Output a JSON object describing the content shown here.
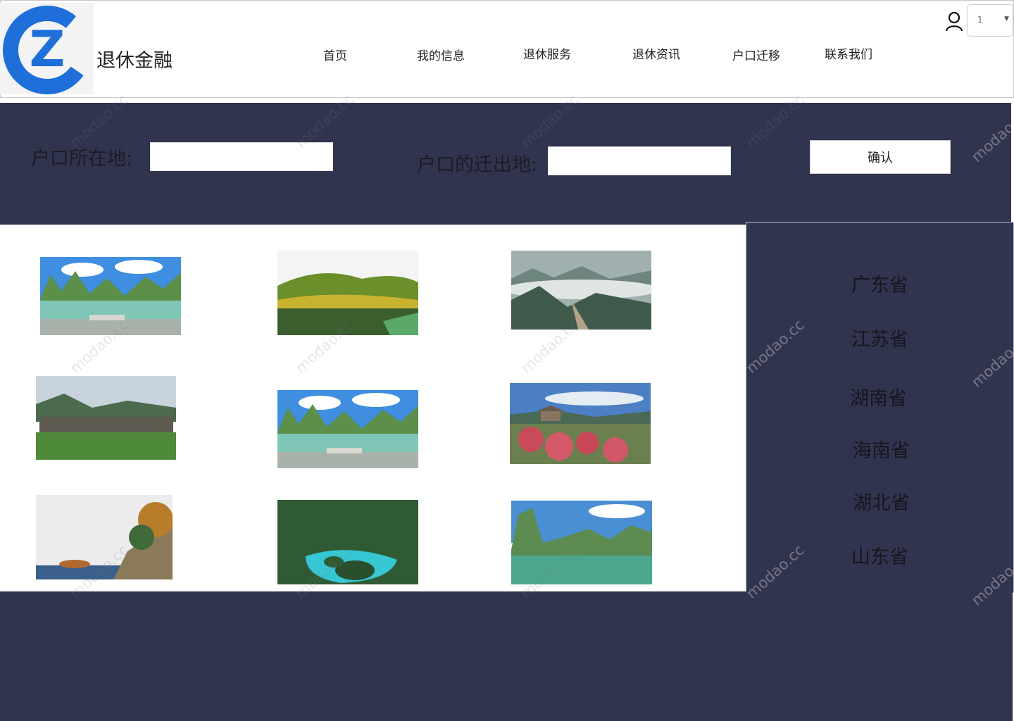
{
  "header": {
    "brand": "退休金融",
    "nav": [
      "首页",
      "我的信息",
      "退休服务",
      "退休资讯",
      "户口迁移",
      "联系我们"
    ],
    "select_value": "1",
    "logo_letter": "Z"
  },
  "search": {
    "label_origin": "户口所在地:",
    "label_destination": "户口的迁出地:",
    "origin_value": "",
    "destination_value": "",
    "confirm_label": "确认"
  },
  "gallery": {
    "images": [
      "karst-lake-river",
      "green-hill-lake",
      "misty-mountains",
      "old-village-pond",
      "karst-lake-river",
      "peach-blossom-pavilion",
      "seaside-cliff",
      "turquoise-lagoon",
      "karst-river-reflection"
    ]
  },
  "provinces": [
    "广东省",
    "江苏省",
    "湖南省",
    "海南省",
    "湖北省",
    "山东省"
  ],
  "watermark": "modao.cc",
  "colors": {
    "band": "#31344e",
    "logo_blue": "#1e6fd9"
  }
}
